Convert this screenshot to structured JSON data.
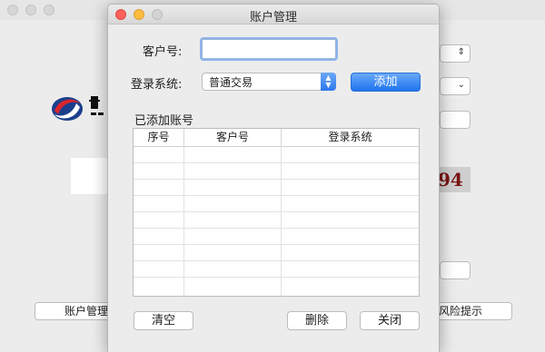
{
  "background": {
    "banner_number": "94",
    "button_left": "账户管理",
    "button_right": "风险提示"
  },
  "dialog": {
    "title": "账户管理",
    "customer_label": "客户号:",
    "customer_value": "",
    "system_label": "登录系统:",
    "system_selected": "普通交易",
    "add_button": "添加",
    "section_label": "已添加账号",
    "table": {
      "headers": [
        "序号",
        "客户号",
        "登录系统"
      ],
      "rows": []
    },
    "clear_button": "清空",
    "delete_button": "删除",
    "close_button": "关闭"
  },
  "colors": {
    "accent": "#2c78ef",
    "close_light": "#fc605c",
    "minimize_light": "#fdbc40",
    "zoom_light": "#d3d3d3"
  }
}
